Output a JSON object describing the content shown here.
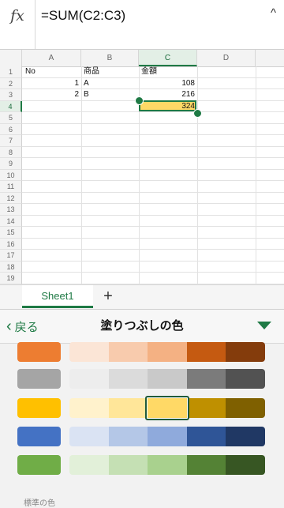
{
  "formula_bar": {
    "fx": "fx",
    "formula": "=SUM(C2:C3)",
    "collapse": "^"
  },
  "columns": [
    "A",
    "B",
    "C",
    "D"
  ],
  "rows": [
    "1",
    "2",
    "3",
    "4",
    "5",
    "6",
    "7",
    "8",
    "9",
    "10",
    "11",
    "12",
    "13",
    "14",
    "15",
    "16",
    "17",
    "18",
    "19"
  ],
  "cells": {
    "A1": "No",
    "B1": "商品",
    "C1": "金額",
    "A2": "1",
    "B2": "A",
    "C2": "108",
    "A3": "2",
    "B3": "B",
    "C3": "216",
    "C4": "324"
  },
  "selection": {
    "cell": "C4",
    "fill": "#ffd966"
  },
  "sheet_tabs": {
    "active": "Sheet1",
    "add": "+"
  },
  "panel": {
    "back_label": "戻る",
    "title": "塗りつぶしの色",
    "footer_label": "標準の色"
  },
  "palette": [
    {
      "base": "#ed7d31",
      "shades": [
        "#fbe5d6",
        "#f8cbad",
        "#f4b183",
        "#c55a11",
        "#843c0c"
      ]
    },
    {
      "base": "#a5a5a5",
      "shades": [
        "#ededed",
        "#dbdbdb",
        "#c9c9c9",
        "#7b7b7b",
        "#525252"
      ]
    },
    {
      "base": "#ffc000",
      "shades": [
        "#fff2cc",
        "#ffe699",
        "#ffd966",
        "#bf9000",
        "#7f6000"
      ]
    },
    {
      "base": "#4472c4",
      "shades": [
        "#dae3f3",
        "#b4c7e7",
        "#8faadc",
        "#2f5597",
        "#203864"
      ]
    },
    {
      "base": "#70ad47",
      "shades": [
        "#e2f0d9",
        "#c5e0b4",
        "#a9d18e",
        "#548235",
        "#375623"
      ]
    }
  ],
  "accent": "#1f7a45"
}
